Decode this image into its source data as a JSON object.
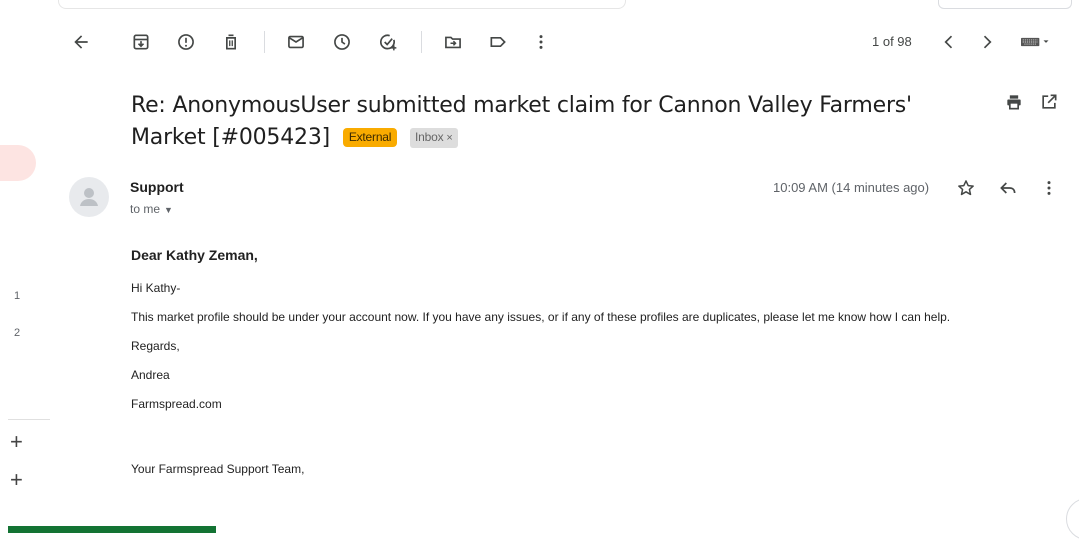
{
  "toolbar": {
    "pager": "1 of 98"
  },
  "message": {
    "subject": "Re: AnonymousUser submitted market claim for Cannon Valley Farmers' Market [#005423]",
    "label_external": "External",
    "label_inbox": "Inbox",
    "label_inbox_remove": "×",
    "sender": "Support",
    "to": "to me",
    "time": "10:09 AM (14 minutes ago)"
  },
  "body": {
    "greeting": "Dear Kathy Zeman,",
    "line1": "Hi Kathy-",
    "line2": "This market profile should be under your account now. If you have any issues, or if any of these profiles are duplicates, please let me know how I can help.",
    "line3": "Regards,",
    "line4": "Andrea",
    "line5": "Farmspread.com",
    "line6": "Your Farmspread Support Team,"
  },
  "leftrail": {
    "num1": "1",
    "num2": "2"
  },
  "colors": {
    "external_badge": "#f9ab00",
    "inbox_badge": "#dddddd",
    "green_bar": "#137333",
    "left_accent": "#fde4e2"
  }
}
